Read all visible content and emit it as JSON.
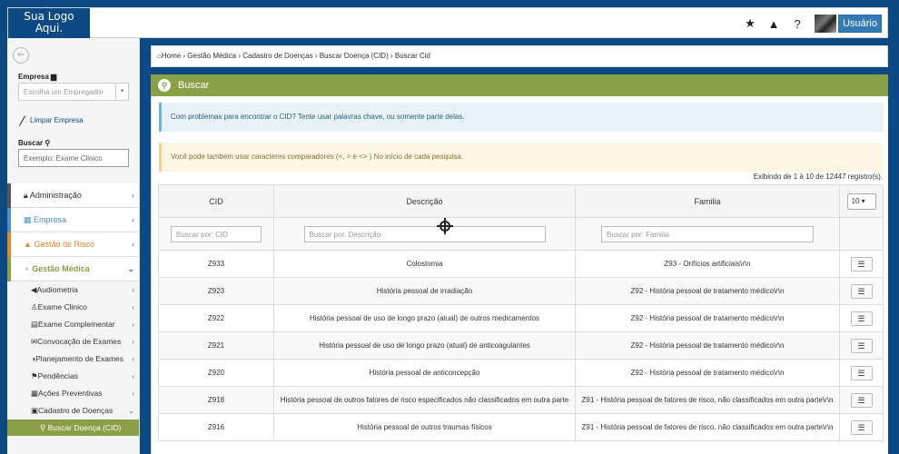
{
  "header": {
    "logo": [
      "Sua Logo",
      "Aqui."
    ],
    "icons": [
      "star-icon",
      "warning-icon",
      "help-icon"
    ],
    "user_label": "Usuário"
  },
  "sidebar": {
    "collapse_icon": "arrow-left-circle-icon",
    "empresa_label": "Empresa",
    "empresa_placeholder": "Escolha um Empregador",
    "clear_label": "Limpar Empresa",
    "buscar_label": "Buscar",
    "buscar_placeholder": "Exemplo: Exame Clinico",
    "menu": [
      {
        "label": "Administração",
        "color": "#555555"
      },
      {
        "label": "Empresa",
        "color": "#4a90c9"
      },
      {
        "label": "Gestão de Risco",
        "color": "#e6832b"
      },
      {
        "label": "Gestão Médica",
        "color": "#8aa046"
      }
    ],
    "submenu": [
      "Audiometria",
      "Exame Clinico",
      "Exame Complementar",
      "Convocação de Exames",
      "Planejamento de Exames",
      "Pendências",
      "Ações Preventivas",
      "Cadastro de Doenças"
    ],
    "active_sub": "Buscar Doença (CID)"
  },
  "breadcrumb": [
    "Home",
    "Gestão Médica",
    "Cadastro de Doenças",
    "Buscar Doença (CID)",
    "Buscar Cid"
  ],
  "panel": {
    "title": "Buscar",
    "info_alert": "Com problemas para encontrar o CID? Tente usar palavras chave, ou somente parte delas.",
    "warn_alert": "Você pode também usar caracteres comparadores (<, > e <> ) No início de cada pesquisa.",
    "records": "Exibindo de 1 à 10 de 12447 registro(s)."
  },
  "table": {
    "headers": [
      "CID",
      "Descrição",
      "Familia"
    ],
    "page_size": "10",
    "filters": {
      "cid": "Buscar por: CID",
      "descricao": "Buscar por: Descrição",
      "familia": "Buscar por: Familia"
    },
    "rows": [
      {
        "cid": "Z933",
        "descricao": "Colostomia",
        "familia": "Z93 - Orifícios artificiais\\r\\n"
      },
      {
        "cid": "Z923",
        "descricao": "História pessoal de irradiação",
        "familia": "Z92 - História pessoal de tratamento médico\\r\\n"
      },
      {
        "cid": "Z922",
        "descricao": "História pessoal de uso de longo prazo (atual) de outros medicamentos",
        "familia": "Z92 - História pessoal de tratamento médico\\r\\n"
      },
      {
        "cid": "Z921",
        "descricao": "História pessoal de uso de longo prazo (atual) de anticoagulantes",
        "familia": "Z92 - História pessoal de tratamento médico\\r\\n"
      },
      {
        "cid": "Z920",
        "descricao": "História pessoal de anticoncepção",
        "familia": "Z92 - História pessoal de tratamento médico\\r\\n"
      },
      {
        "cid": "Z918",
        "descricao": "História pessoal de outros fatores de risco especificados não classificados em outra parte",
        "familia": "Z91 - História pessoal de fatores de risco, não classificados em outra parte\\r\\n"
      },
      {
        "cid": "Z916",
        "descricao": "História pessoal de outros traumas físicos",
        "familia": "Z91 - História pessoal de fatores de risco, não classificados em outra parte\\r\\n"
      }
    ]
  }
}
